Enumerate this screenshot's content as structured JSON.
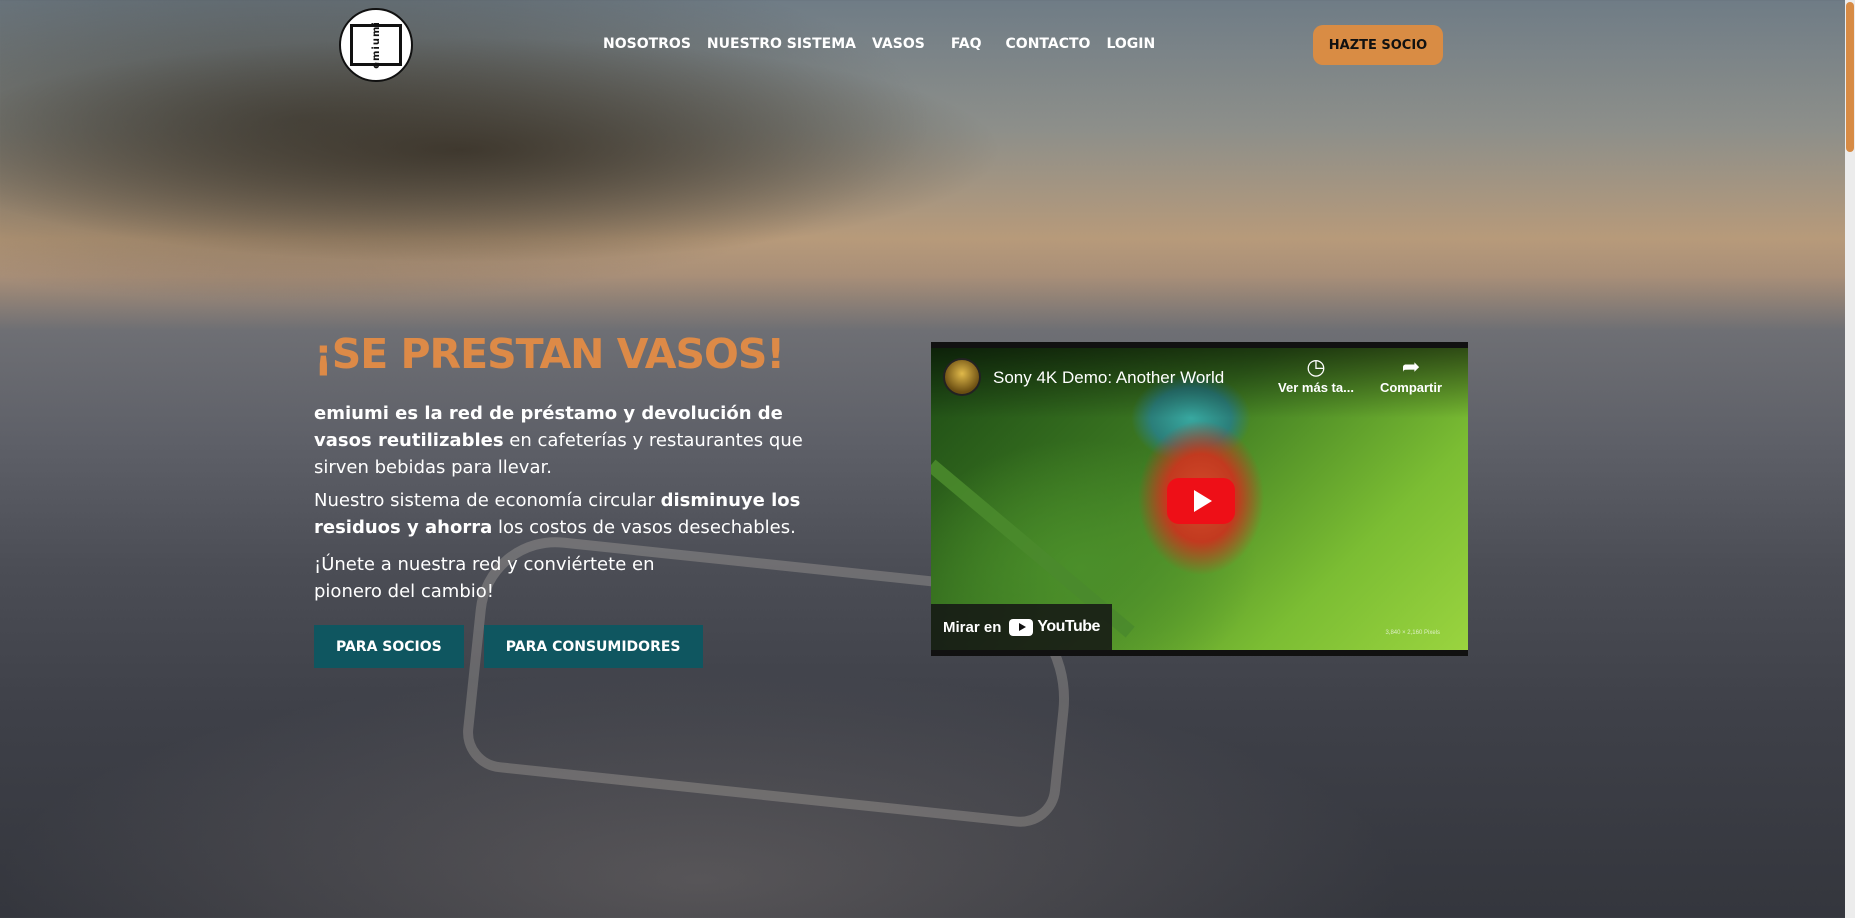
{
  "nav": {
    "logo_text": "emiumi",
    "items": [
      "NOSOTROS",
      "NUESTRO SISTEMA",
      "VASOS",
      "FAQ",
      "CONTACTO",
      "LOGIN"
    ],
    "cta": "HAZTE SOCIO"
  },
  "hero": {
    "title": "¡SE PRESTAN VASOS!",
    "p1_bold": "emiumi es la red de préstamo y devolución de vasos reutilizables",
    "p1_rest": " en cafeterías y restaurantes que sirven bebidas para llevar.",
    "p2_start": "Nuestro sistema de economía circular ",
    "p2_bold": "disminuye los residuos y ahorra",
    "p2_end": " los costos de vasos desechables.",
    "p3": "¡Únete a nuestra red y conviértete en pionero del cambio!",
    "btn_socios": "PARA SOCIOS",
    "btn_consumidores": "PARA CONSUMIDORES"
  },
  "video": {
    "title": "Sony 4K Demo: Another World",
    "watch_later": "Ver más ta...",
    "share": "Compartir",
    "watch_on": "Mirar en",
    "youtube": "YouTube",
    "resolution": "3,840 × 2,160 Pixels"
  },
  "colors": {
    "accent": "#d98c44",
    "button_teal": "#0f5660",
    "youtube_red": "#ee0f17"
  }
}
